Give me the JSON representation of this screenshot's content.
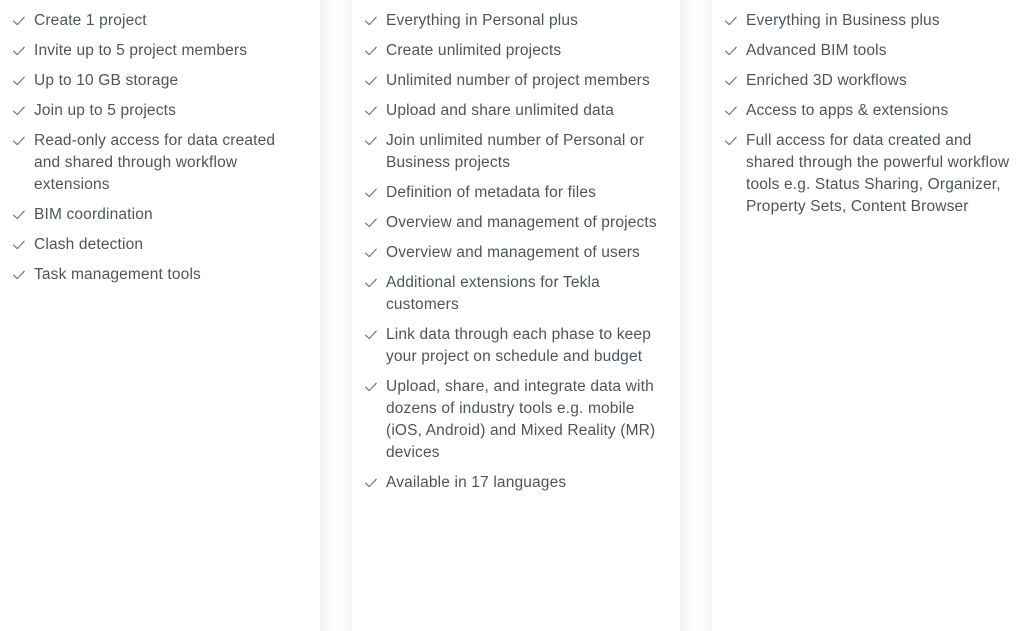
{
  "accent_colors": {
    "text": "#4c555d",
    "check": "#6d767e",
    "background": "#ffffff",
    "divider_shadow": "rgba(0,0,0,0.05)"
  },
  "icons": {
    "check": "check-icon"
  },
  "columns": [
    {
      "id": "personal",
      "name": "personal-plan-features",
      "features": [
        "Create 1 project",
        "Invite up to 5 project members",
        "Up to 10 GB storage",
        "Join up to 5 projects",
        "Read-only access for data created and shared through workflow extensions",
        "BIM coordination",
        "Clash detection",
        "Task management tools"
      ]
    },
    {
      "id": "business",
      "name": "business-plan-features",
      "features": [
        "Everything in Personal plus",
        "Create unlimited projects",
        "Unlimited number of project members",
        "Upload and share unlimited data",
        "Join unlimited number of Personal or Business projects",
        "Definition of metadata for files",
        "Overview and management of projects",
        "Overview and management of users",
        "Additional extensions for Tekla customers",
        "Link data through each phase to keep your project on schedule and budget",
        "Upload, share, and integrate data with dozens of industry tools e.g. mobile (iOS, Android) and Mixed Reality (MR) devices",
        "Available in 17 languages"
      ]
    },
    {
      "id": "enterprise",
      "name": "enterprise-plan-features",
      "features": [
        "Everything in Business plus",
        "Advanced BIM tools",
        "Enriched 3D workflows",
        "Access to apps & extensions",
        "Full access for data created and shared through the powerful workflow tools e.g. Status Sharing, Organizer, Property Sets, Content Browser"
      ]
    }
  ]
}
